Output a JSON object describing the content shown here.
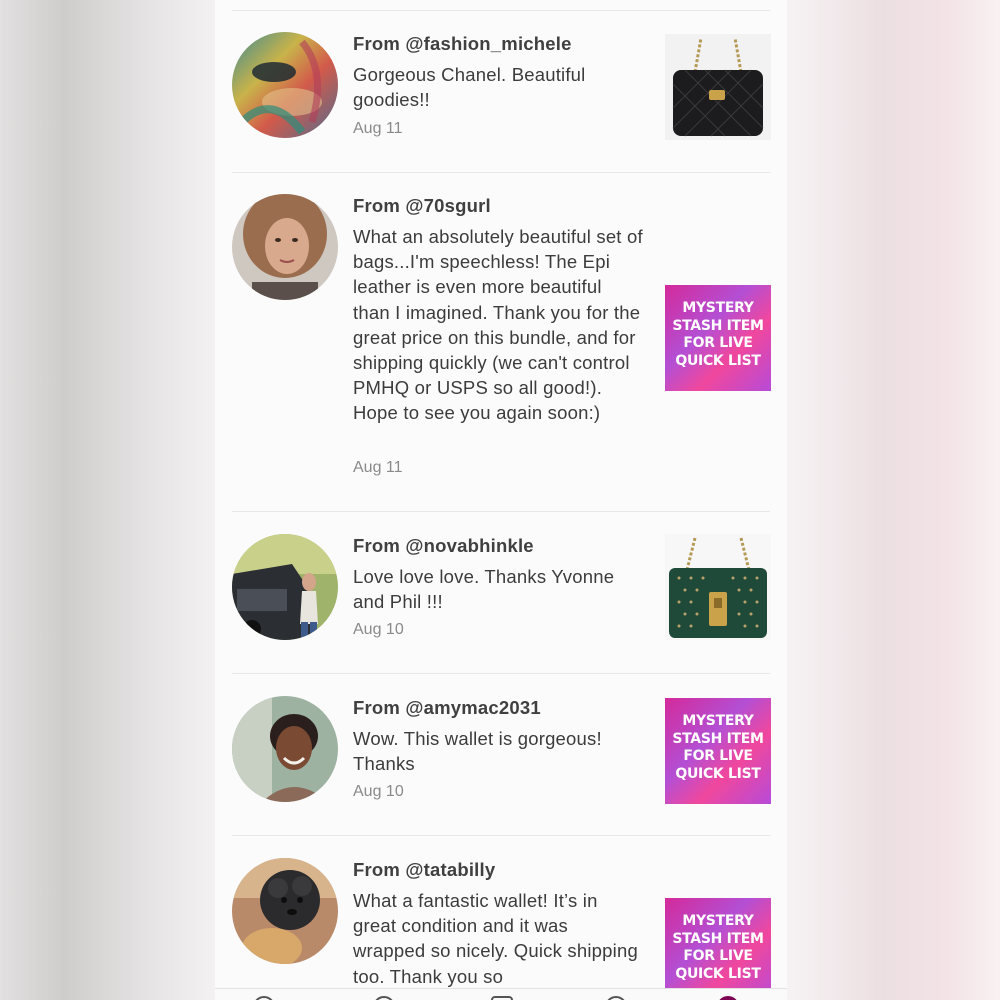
{
  "reviews": [
    {
      "from": "From @fashion_michele",
      "text": "Gorgeous Chanel. Beautiful goodies!!",
      "date": "Aug 11",
      "thumb": "black-quilted-bag"
    },
    {
      "from": "From @70sgurl",
      "text": "What an absolutely beautiful set of bags...I'm speechless! The Epi leather is even more beautiful than I imagined. Thank you for the great price on this bundle, and for shipping quickly (we can't control PMHQ or USPS so all good!). Hope to see you again soon:)",
      "date": "Aug 11",
      "thumb": "mystery-stash"
    },
    {
      "from": "From @novabhinkle",
      "text": "Love love love. Thanks Yvonne and Phil !!!",
      "date": "Aug 10",
      "thumb": "green-studded-bag"
    },
    {
      "from": "From @amymac2031",
      "text": "Wow. This wallet is gorgeous! Thanks",
      "date": "Aug 10",
      "thumb": "mystery-stash"
    },
    {
      "from": "From @tatabilly",
      "text": "What a fantastic wallet! It’s in great condition and it was wrapped so nicely. Quick shipping too. Thank you so",
      "date": "",
      "thumb": "mystery-stash"
    }
  ],
  "mystery_label": {
    "line1": "MYSTERY",
    "line2": "STASH ITEM",
    "line3": "FOR LIVE",
    "line4": "QUICK LIST"
  },
  "colors": {
    "accent": "#7f0353",
    "text": "#3c3c3c",
    "date": "#8a8a8a"
  }
}
